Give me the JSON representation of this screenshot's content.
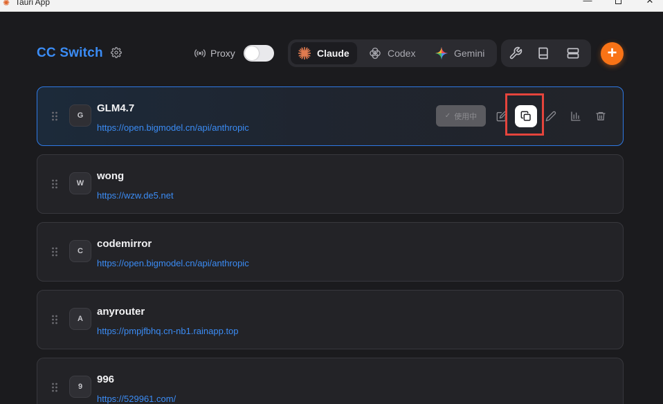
{
  "window": {
    "title": "Tauri App",
    "controls": {
      "minimize": "—",
      "close": "✕"
    }
  },
  "header": {
    "brand": "CC Switch",
    "proxy_label": "Proxy",
    "proxy_enabled": false,
    "tabs": [
      {
        "label": "Claude",
        "icon": "claude-icon",
        "active": true
      },
      {
        "label": "Codex",
        "icon": "openai-icon",
        "active": false
      },
      {
        "label": "Gemini",
        "icon": "gemini-icon",
        "active": false
      }
    ],
    "tools": [
      "wrench-icon",
      "book-icon",
      "layout-icon"
    ],
    "add_label": "+"
  },
  "providers": [
    {
      "initial": "G",
      "name": "GLM4.7",
      "url": "https://open.bigmodel.cn/api/anthropic",
      "active": true,
      "status_label": "使用中"
    },
    {
      "initial": "W",
      "name": "wong",
      "url": "https://wzw.de5.net",
      "active": false
    },
    {
      "initial": "C",
      "name": "codemirror",
      "url": "https://open.bigmodel.cn/api/anthropic",
      "active": false
    },
    {
      "initial": "A",
      "name": "anyrouter",
      "url": "https://pmpjfbhq.cn-nb1.rainapp.top",
      "active": false
    },
    {
      "initial": "9",
      "name": "996",
      "url": "https://529961.com/",
      "active": false
    }
  ],
  "colors": {
    "accent": "#3b8cf5",
    "add_button": "#f97316",
    "highlight": "#e5443c",
    "background": "#1b1b1e"
  }
}
